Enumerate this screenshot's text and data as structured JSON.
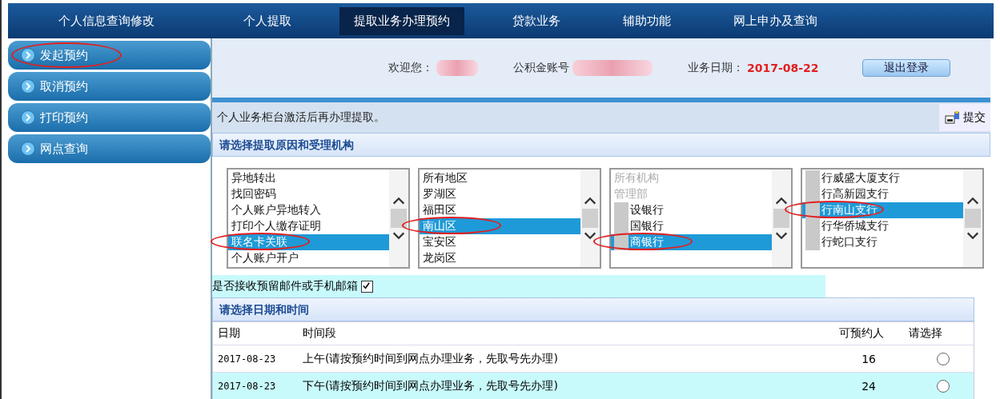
{
  "nav": [
    {
      "label": "个人信息查询修改",
      "selected": false
    },
    {
      "label": "个人提取",
      "selected": false
    },
    {
      "label": "提取业务办理预约",
      "selected": true
    },
    {
      "label": "贷款业务",
      "selected": false
    },
    {
      "label": "辅助功能",
      "selected": false
    },
    {
      "label": "网上申办及查询",
      "selected": false
    }
  ],
  "sidebar": [
    {
      "label": "发起预约",
      "circled": true
    },
    {
      "label": "取消预约",
      "circled": false
    },
    {
      "label": "打印预约",
      "circled": false
    },
    {
      "label": "网点查询",
      "circled": false
    }
  ],
  "header": {
    "welcome_label": "欢迎您：",
    "account_label": "公积金账号",
    "date_label": "业务日期：",
    "date": "2017-08-22",
    "logout": "退出登录"
  },
  "notice": "个人业务柜台激活后再办理提取。",
  "submit": "提交",
  "section1": "请选择提取原因和受理机构",
  "lists": [
    {
      "items": [
        {
          "text": "异地转出",
          "selected": false,
          "disabled": false,
          "redacted": false,
          "circled": false
        },
        {
          "text": "找回密码",
          "selected": false,
          "disabled": false,
          "redacted": false,
          "circled": false
        },
        {
          "text": "个人账户异地转入",
          "selected": false,
          "disabled": false,
          "redacted": false,
          "circled": false
        },
        {
          "text": "打印个人缴存证明",
          "selected": false,
          "disabled": false,
          "redacted": false,
          "circled": false
        },
        {
          "text": "联名卡关联",
          "selected": true,
          "disabled": false,
          "redacted": false,
          "circled": true
        },
        {
          "text": "个人账户开户",
          "selected": false,
          "disabled": false,
          "redacted": false,
          "circled": false
        }
      ]
    },
    {
      "items": [
        {
          "text": "所有地区",
          "selected": false,
          "disabled": false,
          "redacted": false,
          "circled": false
        },
        {
          "text": "罗湖区",
          "selected": false,
          "disabled": false,
          "redacted": false,
          "circled": false
        },
        {
          "text": "福田区",
          "selected": false,
          "disabled": false,
          "redacted": false,
          "circled": false
        },
        {
          "text": "南山区",
          "selected": true,
          "disabled": false,
          "redacted": false,
          "circled": true
        },
        {
          "text": "宝安区",
          "selected": false,
          "disabled": false,
          "redacted": false,
          "circled": false
        },
        {
          "text": "龙岗区",
          "selected": false,
          "disabled": false,
          "redacted": false,
          "circled": false
        }
      ]
    },
    {
      "items": [
        {
          "text": "所有机构",
          "selected": false,
          "disabled": true,
          "redacted": false,
          "circled": false
        },
        {
          "text": "管理部",
          "selected": false,
          "disabled": true,
          "redacted": false,
          "circled": false
        },
        {
          "text": "设银行",
          "selected": false,
          "disabled": false,
          "redacted": true,
          "circled": false
        },
        {
          "text": "国银行",
          "selected": false,
          "disabled": false,
          "redacted": true,
          "circled": false
        },
        {
          "text": "商银行",
          "selected": true,
          "disabled": false,
          "redacted": true,
          "circled": true
        }
      ]
    },
    {
      "items": [
        {
          "text": "行威盛大厦支行",
          "selected": false,
          "disabled": false,
          "redacted": true,
          "circled": false
        },
        {
          "text": "行高新园支行",
          "selected": false,
          "disabled": false,
          "redacted": true,
          "circled": false
        },
        {
          "text": "行南山支行",
          "selected": true,
          "disabled": false,
          "redacted": true,
          "circled": true
        },
        {
          "text": "行华侨城支行",
          "selected": false,
          "disabled": false,
          "redacted": true,
          "circled": false
        },
        {
          "text": "行蛇口支行",
          "selected": false,
          "disabled": false,
          "redacted": true,
          "circled": false
        }
      ]
    }
  ],
  "email_opt": {
    "label": "是否接收预留邮件或手机邮箱",
    "checked": true
  },
  "section2": "请选择日期和时间",
  "table": {
    "columns": [
      "日期",
      "时间段",
      "可预约人",
      "请选择"
    ],
    "rows": [
      {
        "date": "2017-08-23",
        "period": "上午(请按预约时间到网点办理业务，先取号先办理)",
        "count": "16",
        "selected": false
      },
      {
        "date": "2017-08-23",
        "period": "下午(请按预约时间到网点办理业务，先取号先办理)",
        "count": "24",
        "selected": false
      }
    ]
  }
}
